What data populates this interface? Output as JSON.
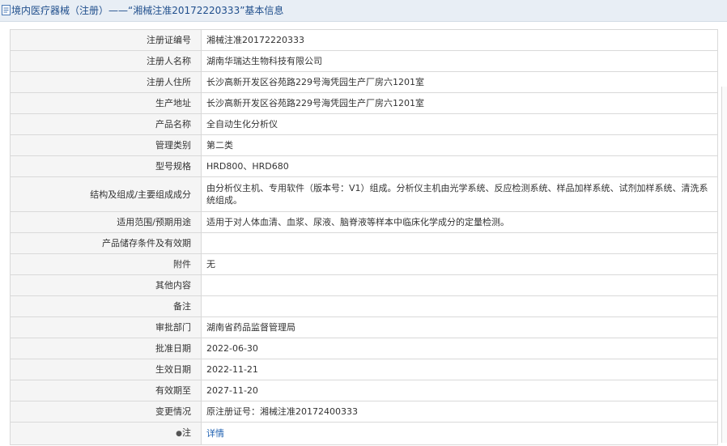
{
  "header": {
    "title": "境内医疗器械（注册）——“湘械注准20172220333”基本信息"
  },
  "rows": [
    {
      "label": "注册证编号",
      "value": "湘械注准20172220333"
    },
    {
      "label": "注册人名称",
      "value": "湖南华瑞达生物科技有限公司"
    },
    {
      "label": "注册人住所",
      "value": "长沙高新开发区谷苑路229号海凭园生产厂房六1201室"
    },
    {
      "label": "生产地址",
      "value": "长沙高新开发区谷苑路229号海凭园生产厂房六1201室"
    },
    {
      "label": "产品名称",
      "value": "全自动生化分析仪"
    },
    {
      "label": "管理类别",
      "value": "第二类"
    },
    {
      "label": "型号规格",
      "value": "HRD800、HRD680"
    },
    {
      "label": "结构及组成/主要组成成分",
      "value": "由分析仪主机、专用软件（版本号：V1）组成。分析仪主机由光学系统、反应检测系统、样品加样系统、试剂加样系统、清洗系统组成。"
    },
    {
      "label": "适用范围/预期用途",
      "value": "适用于对人体血清、血浆、尿液、脑脊液等样本中临床化学成分的定量检测。"
    },
    {
      "label": "产品储存条件及有效期",
      "value": ""
    },
    {
      "label": "附件",
      "value": "无"
    },
    {
      "label": "其他内容",
      "value": ""
    },
    {
      "label": "备注",
      "value": ""
    },
    {
      "label": "审批部门",
      "value": "湖南省药品监督管理局"
    },
    {
      "label": "批准日期",
      "value": "2022-06-30"
    },
    {
      "label": "生效日期",
      "value": "2022-11-21"
    },
    {
      "label": "有效期至",
      "value": "2027-11-20"
    },
    {
      "label": "变更情况",
      "value": "原注册证号：湘械注准20172400333"
    }
  ],
  "note": {
    "label": "注",
    "link": "详情"
  }
}
